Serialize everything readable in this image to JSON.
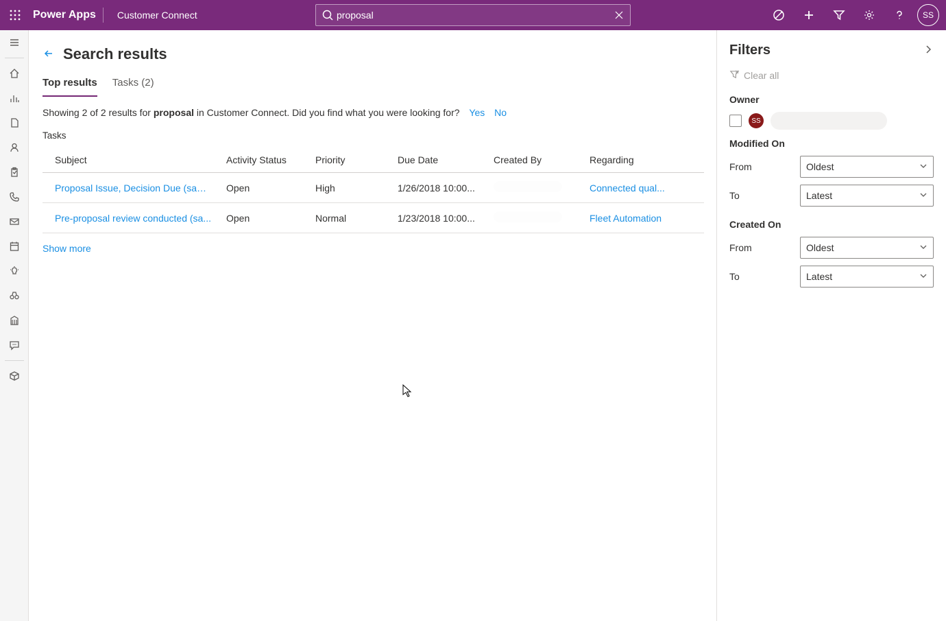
{
  "topbar": {
    "brand": "Power Apps",
    "app_name": "Customer Connect",
    "search_value": "proposal",
    "avatar": "SS"
  },
  "page": {
    "title": "Search results",
    "tabs": [
      {
        "label": "Top results",
        "active": true
      },
      {
        "label": "Tasks (2)",
        "active": false
      }
    ],
    "summary_pre": "Showing 2 of 2 results for ",
    "summary_query": "proposal",
    "summary_post": " in Customer Connect. Did you find what you were looking for?",
    "yes": "Yes",
    "no": "No",
    "section_label": "Tasks",
    "columns": {
      "subject": "Subject",
      "activity_status": "Activity Status",
      "priority": "Priority",
      "due_date": "Due Date",
      "created_by": "Created By",
      "regarding": "Regarding"
    },
    "rows": [
      {
        "subject": "Proposal Issue, Decision Due (sampl...",
        "activity_status": "Open",
        "priority": "High",
        "due_date": "1/26/2018 10:00...",
        "created_by": "",
        "regarding": "Connected qual..."
      },
      {
        "subject": "Pre-proposal review conducted (sa...",
        "activity_status": "Open",
        "priority": "Normal",
        "due_date": "1/23/2018 10:00...",
        "created_by": "",
        "regarding": "Fleet Automation"
      }
    ],
    "show_more": "Show more"
  },
  "filters": {
    "title": "Filters",
    "clear_all": "Clear all",
    "owner_label": "Owner",
    "owner_initials": "SS",
    "modified_on_label": "Modified On",
    "created_on_label": "Created On",
    "from_label": "From",
    "to_label": "To",
    "oldest": "Oldest",
    "latest": "Latest"
  }
}
